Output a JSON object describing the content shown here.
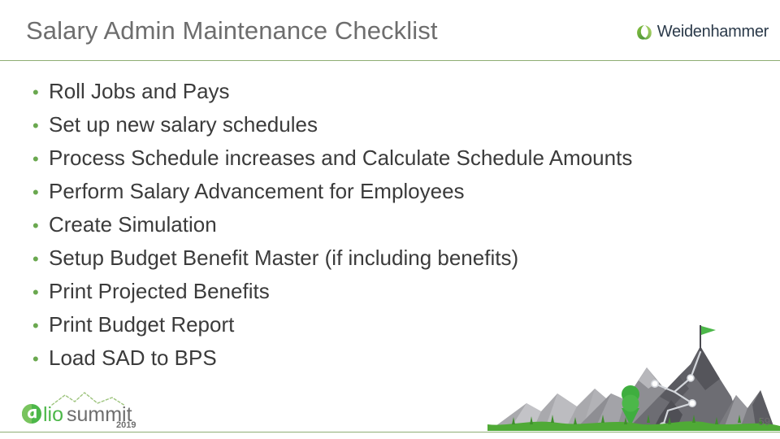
{
  "slide": {
    "title": "Salary Admin Maintenance Checklist",
    "page_number": "59"
  },
  "colors": {
    "title_gray": "#6e6e6e",
    "body_gray": "#3b3b3b",
    "accent_green": "#6aa84f",
    "rule_green": "#8fae74",
    "brand_navy": "#2b3a4a",
    "grass_green": "#5cb33c",
    "mountain_light": "#9a9a9e",
    "mountain_mid": "#7c7c81",
    "mountain_dark": "#58585d"
  },
  "checklist": {
    "bullet_glyph": "•",
    "items": [
      "Roll Jobs and Pays",
      "Set up new salary schedules",
      "Process Schedule increases and Calculate Schedule Amounts",
      "Perform Salary Advancement for Employees",
      "Create Simulation",
      "Setup Budget Benefit Master (if including benefits)",
      "Print Projected Benefits",
      "Print Budget Report",
      "Load SAD to BPS"
    ]
  },
  "brands": {
    "weidenhammer": {
      "name": "Weidenhammer",
      "icon": "leaf-swoosh-icon"
    },
    "alio_summit": {
      "a_letter": "a",
      "lio": "lio",
      "summit": "summit",
      "year": "2019",
      "icon": "alio-circle-icon"
    }
  },
  "artwork": {
    "mountain": "mountain-range-illustration",
    "flag": "summit-flag-icon",
    "pin": "map-pin-icon"
  }
}
